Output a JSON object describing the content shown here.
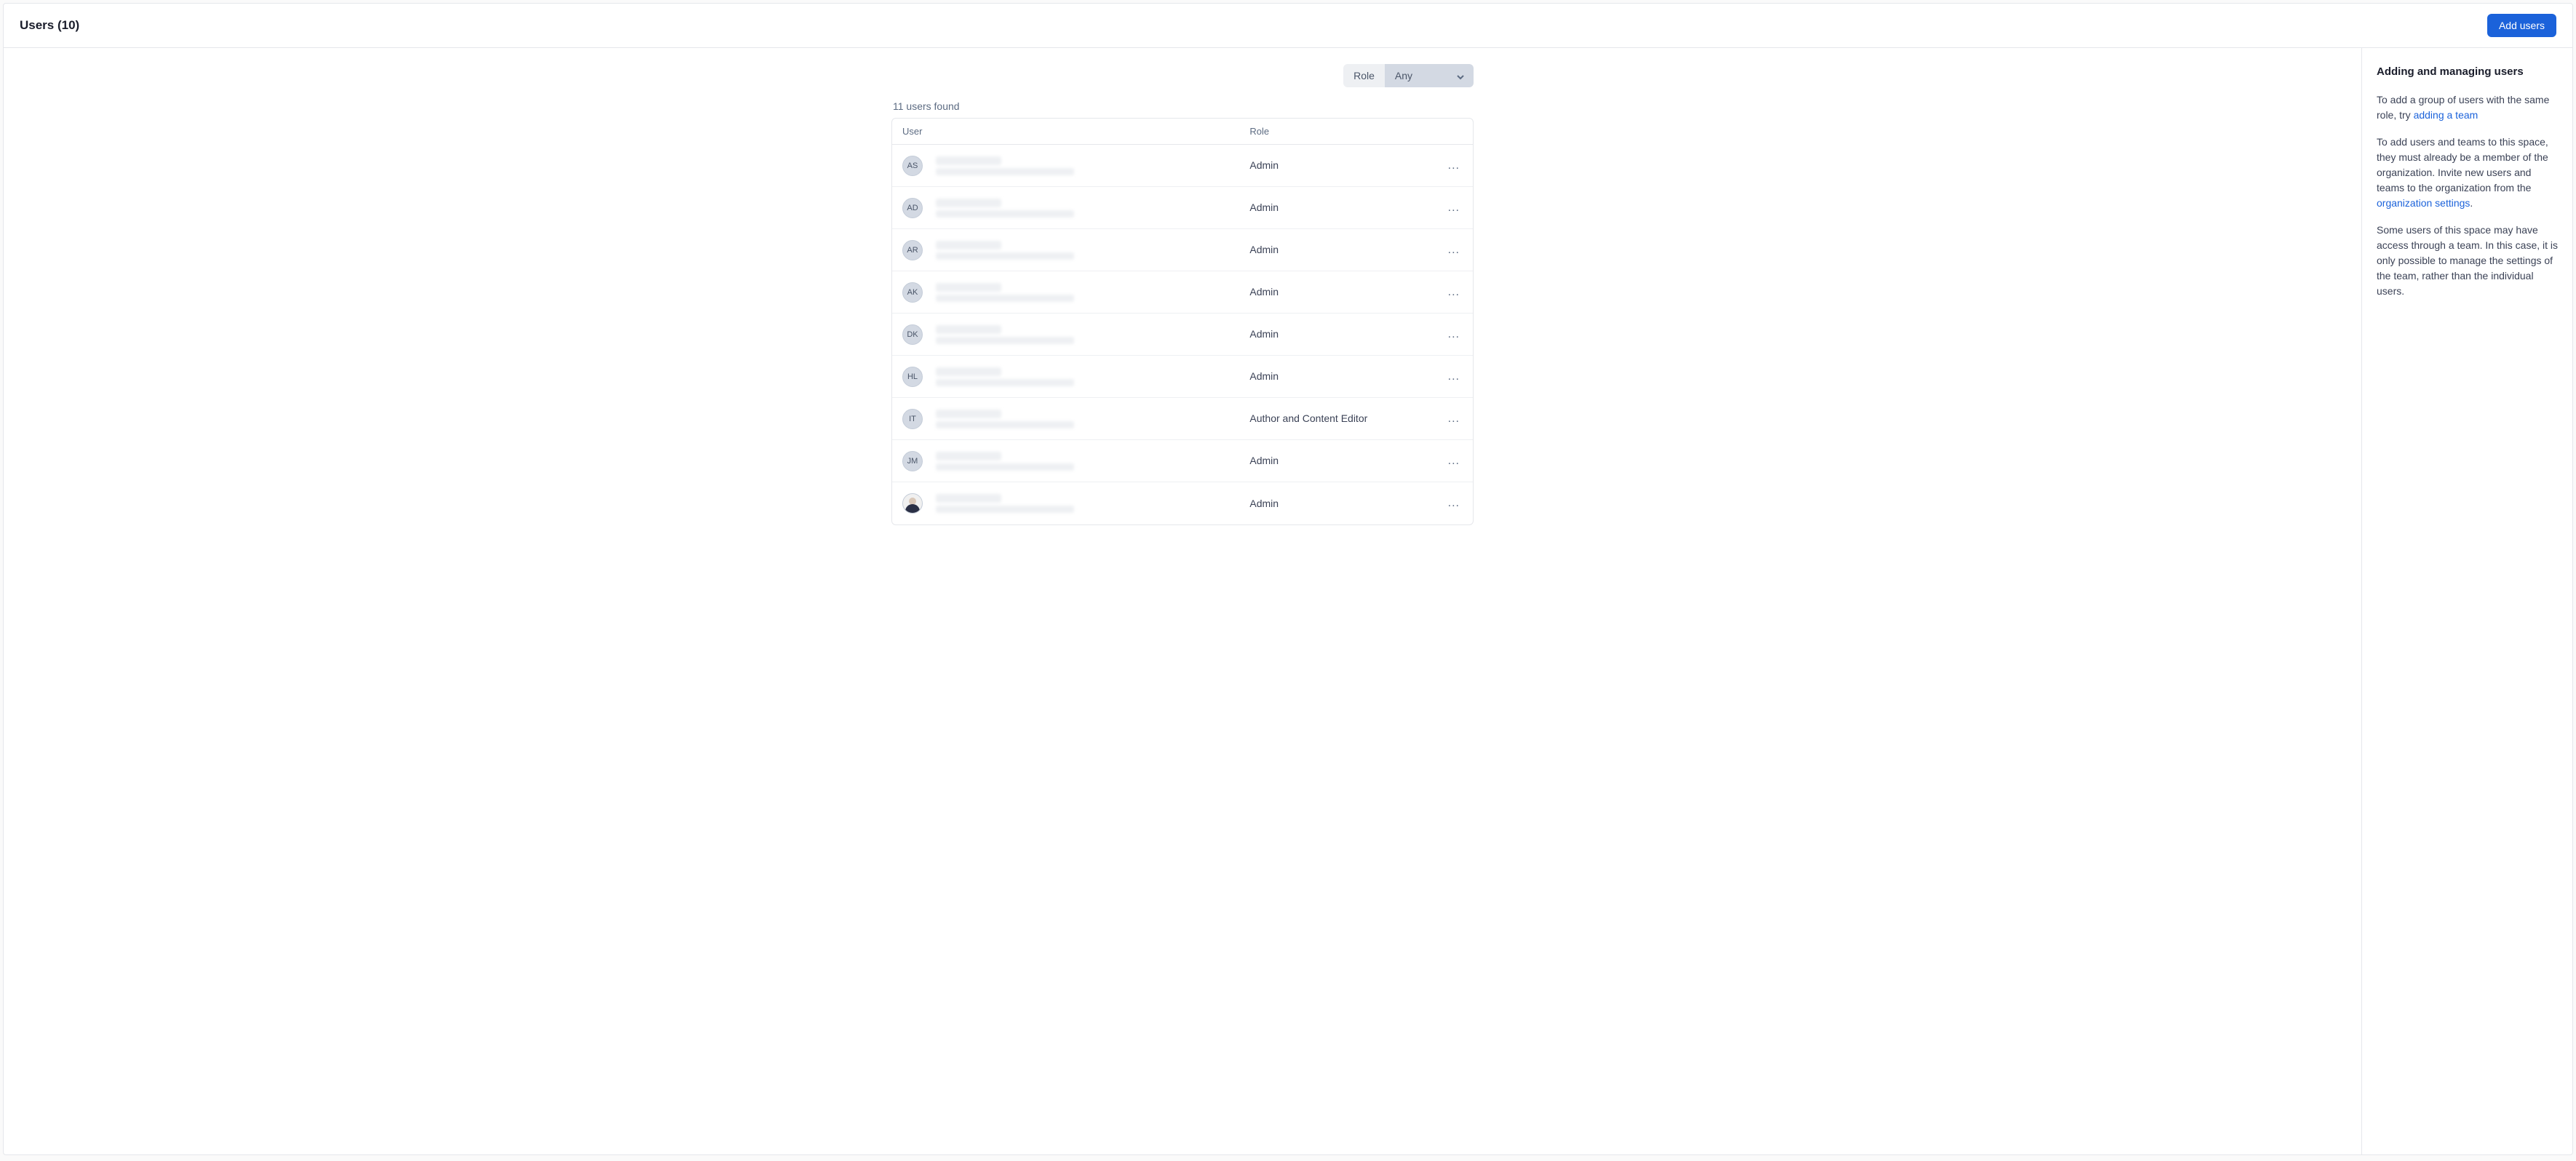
{
  "header": {
    "title": "Users (10)",
    "add_users_label": "Add users"
  },
  "filter": {
    "label": "Role",
    "selected": "Any"
  },
  "found_text": "11 users found",
  "table": {
    "col_user": "User",
    "col_role": "Role"
  },
  "users": [
    {
      "initials": "AS",
      "role": "Admin",
      "photo": false
    },
    {
      "initials": "AD",
      "role": "Admin",
      "photo": false
    },
    {
      "initials": "AR",
      "role": "Admin",
      "photo": false
    },
    {
      "initials": "AK",
      "role": "Admin",
      "photo": false
    },
    {
      "initials": "DK",
      "role": "Admin",
      "photo": false
    },
    {
      "initials": "HL",
      "role": "Admin",
      "photo": false
    },
    {
      "initials": "IT",
      "role": "Author and Content Editor",
      "photo": false
    },
    {
      "initials": "JM",
      "role": "Admin",
      "photo": false
    },
    {
      "initials": "",
      "role": "Admin",
      "photo": true
    }
  ],
  "sidebar": {
    "heading": "Adding and managing users",
    "p1_a": "To add a group of users with the same role, try ",
    "p1_link": "adding a team",
    "p2_a": "To add users and teams to this space, they must already be a member of the organization. Invite new users and teams to the organization from the ",
    "p2_link": "organization settings",
    "p2_b": ".",
    "p3": "Some users of this space may have access through a team. In this case, it is only possible to manage the settings of the team, rather than the individual users."
  },
  "actions_glyph": "..."
}
